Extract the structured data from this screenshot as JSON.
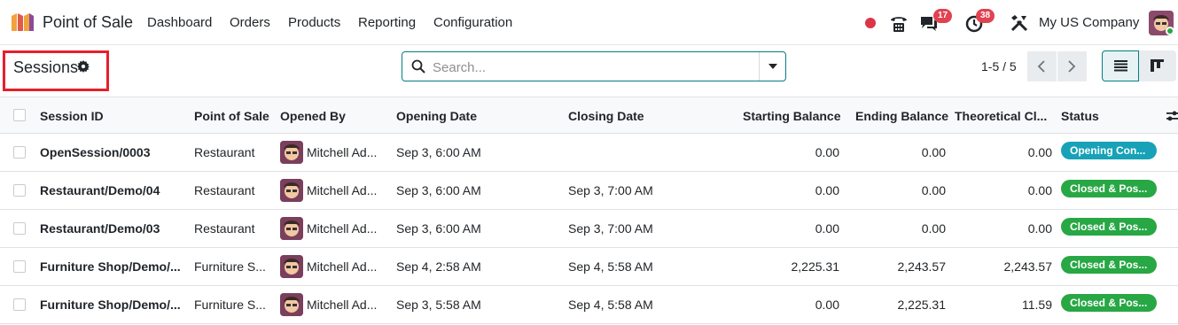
{
  "nav": {
    "app_title": "Point of Sale",
    "menu": [
      "Dashboard",
      "Orders",
      "Products",
      "Reporting",
      "Configuration"
    ],
    "messages_count": "17",
    "activities_count": "38",
    "company": "My US Company"
  },
  "control": {
    "title": "Sessions",
    "search_placeholder": "Search...",
    "pager": "1-5 / 5"
  },
  "table": {
    "headers": [
      "Session ID",
      "Point of Sale",
      "Opened By",
      "Opening Date",
      "Closing Date",
      "Starting Balance",
      "Ending Balance",
      "Theoretical Cl...",
      "Status"
    ],
    "rows": [
      {
        "session_id": "OpenSession/0003",
        "pos": "Restaurant",
        "opened_by": "Mitchell Ad...",
        "opening_date": "Sep 3, 6:00 AM",
        "closing_date": "",
        "starting": "0.00",
        "ending": "0.00",
        "theoretical": "0.00",
        "status": "Opening Con...",
        "status_color": "#17a2b8"
      },
      {
        "session_id": "Restaurant/Demo/04",
        "pos": "Restaurant",
        "opened_by": "Mitchell Ad...",
        "opening_date": "Sep 3, 6:00 AM",
        "closing_date": "Sep 3, 7:00 AM",
        "starting": "0.00",
        "ending": "0.00",
        "theoretical": "0.00",
        "status": "Closed & Pos...",
        "status_color": "#28a745"
      },
      {
        "session_id": "Restaurant/Demo/03",
        "pos": "Restaurant",
        "opened_by": "Mitchell Ad...",
        "opening_date": "Sep 3, 6:00 AM",
        "closing_date": "Sep 3, 7:00 AM",
        "starting": "0.00",
        "ending": "0.00",
        "theoretical": "0.00",
        "status": "Closed & Pos...",
        "status_color": "#28a745"
      },
      {
        "session_id": "Furniture Shop/Demo/...",
        "pos": "Furniture S...",
        "opened_by": "Mitchell Ad...",
        "opening_date": "Sep 4, 2:58 AM",
        "closing_date": "Sep 4, 5:58 AM",
        "starting": "2,225.31",
        "ending": "2,243.57",
        "theoretical": "2,243.57",
        "status": "Closed & Pos...",
        "status_color": "#28a745"
      },
      {
        "session_id": "Furniture Shop/Demo/...",
        "pos": "Furniture S...",
        "opened_by": "Mitchell Ad...",
        "opening_date": "Sep 3, 5:58 AM",
        "closing_date": "Sep 4, 5:58 AM",
        "starting": "0.00",
        "ending": "2,225.31",
        "theoretical": "11.59",
        "status": "Closed & Pos...",
        "status_color": "#28a745"
      }
    ]
  },
  "colors": {
    "accent": "#017e84",
    "badge": "#e04250",
    "status_open": "#17a2b8",
    "status_closed": "#28a745"
  },
  "icons": [
    "app-logo-icon",
    "status-dot-icon",
    "phone-icon",
    "chat-icon",
    "activity-clock-icon",
    "tools-icon",
    "gear-icon",
    "search-icon",
    "chevron-left-icon",
    "chevron-right-icon",
    "list-view-icon",
    "kanban-view-icon",
    "optional-columns-icon"
  ]
}
